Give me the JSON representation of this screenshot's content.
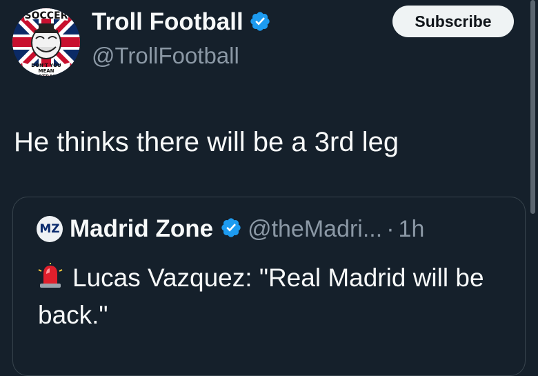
{
  "author": {
    "name": "Troll Football",
    "handle": "@TrollFootball",
    "verified": true,
    "avatar": {
      "top_text": "SOCCER",
      "bottom_text": "DON'T YOU MEAN FOOTBALL?"
    }
  },
  "actions": {
    "subscribe_label": "Subscribe"
  },
  "tweet": {
    "text": "He thinks there will be a 3rd leg"
  },
  "quoted": {
    "avatar_text": "MZ",
    "name": "Madrid Zone",
    "verified": true,
    "handle": "@theMadri...",
    "separator": "·",
    "time": "1h",
    "icon": "police-light-icon",
    "body": "Lucas Vazquez: \"Real Madrid will be back.\""
  },
  "colors": {
    "background": "#15202b",
    "verified_badge": "#1d9bf0",
    "secondary_text": "#8b98a5",
    "subscribe_bg": "#eff3f4"
  }
}
